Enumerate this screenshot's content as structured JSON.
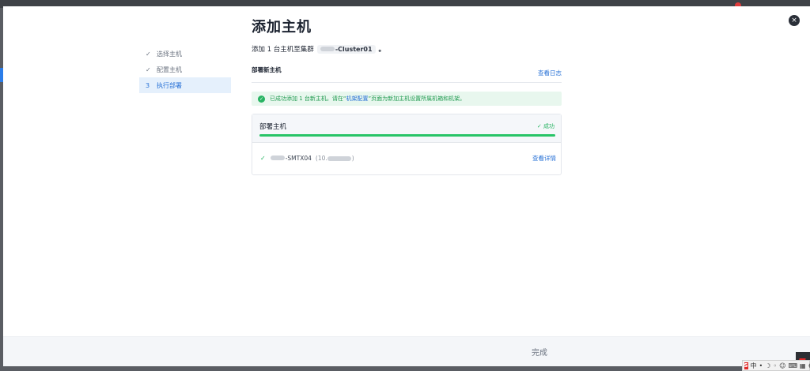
{
  "page_title": "添加主机",
  "subtitle": {
    "prefix": "添加 1 台主机至集群",
    "cluster": "-Cluster01",
    "suffix": "。"
  },
  "steps": [
    {
      "mark": "✓",
      "label": "选择主机"
    },
    {
      "mark": "✓",
      "label": "配置主机"
    },
    {
      "mark": "3",
      "label": "执行部署"
    }
  ],
  "section": {
    "label": "部署新主机",
    "view_log": "查看日志"
  },
  "banner": {
    "icon": "check-circle-icon",
    "text_before": "已成功添加 1 台新主机。请在“",
    "link": "机架配置",
    "text_after": "”页面为新加主机设置所属机箱和机架。"
  },
  "deploy_card": {
    "title": "部署主机",
    "status_mark": "✓",
    "status": "成功",
    "progress_percent": 100,
    "host": {
      "mark": "✓",
      "name": "-SMTX04",
      "ip_prefix": "(10.",
      "ip_suffix": ")",
      "view_detail": "查看详情"
    }
  },
  "footer": {
    "done_label": "完成"
  },
  "close_label": "×",
  "tray": {
    "ime": "S",
    "lang": "中",
    "items": [
      "•",
      "☽",
      "◦",
      "☺",
      "⌨",
      "▦",
      "⚙",
      "▣"
    ]
  },
  "colors": {
    "accent": "#2670d6",
    "success": "#28b463",
    "title": "#1c2330"
  }
}
